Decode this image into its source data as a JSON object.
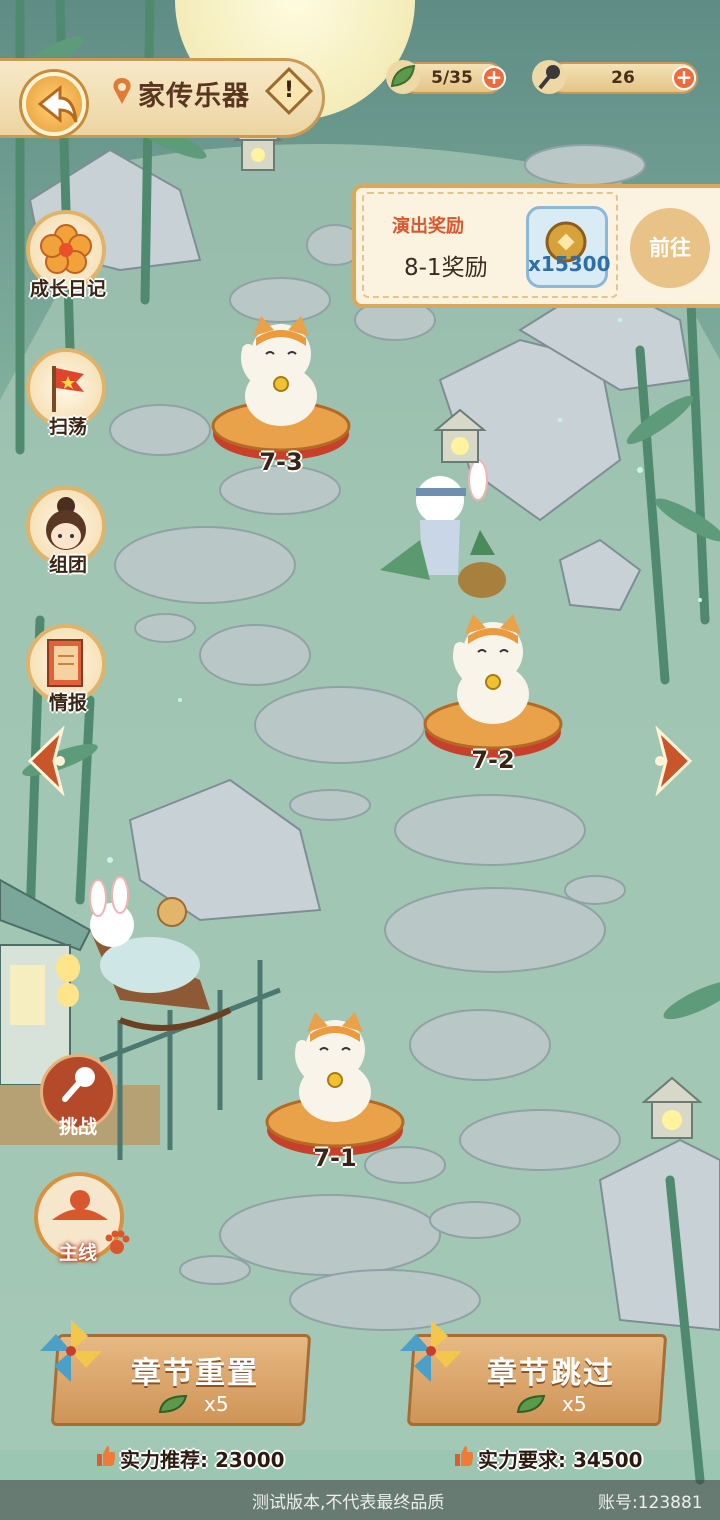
{
  "header": {
    "title": "家传乐器",
    "info_symbol": "!",
    "resources": [
      {
        "icon": "leaf-icon",
        "value": "5/35"
      },
      {
        "icon": "microphone-icon",
        "value": "26"
      }
    ],
    "plus_symbol": "+"
  },
  "reward": {
    "label": "演出奖励",
    "subtitle": "8-1奖励",
    "coin_count": "x15300",
    "go_label": "前往"
  },
  "side_menu": [
    {
      "icon": "flower-icon",
      "label": "成长日记"
    },
    {
      "icon": "flag-icon",
      "label": "扫荡"
    },
    {
      "icon": "girl-avatar-icon",
      "label": "组团"
    },
    {
      "icon": "book-icon",
      "label": "情报"
    }
  ],
  "stages": [
    {
      "label": "7-3"
    },
    {
      "label": "7-2"
    },
    {
      "label": "7-1"
    }
  ],
  "modes": {
    "challenge": "挑战",
    "main": "主线"
  },
  "actions": {
    "reset_label": "章节重置",
    "reset_cost": "x5",
    "skip_label": "章节跳过",
    "skip_cost": "x5"
  },
  "power": {
    "recommend": "实力推荐: 23000",
    "require": "实力要求: 34500"
  },
  "footer": {
    "notice": "测试版本,不代表最终品质",
    "account": "账号:123881"
  },
  "colors": {
    "accent_orange": "#e89b33",
    "wood": "#cf9457",
    "reward_red": "#d9572e",
    "coin_blue": "#2f6fa8"
  }
}
